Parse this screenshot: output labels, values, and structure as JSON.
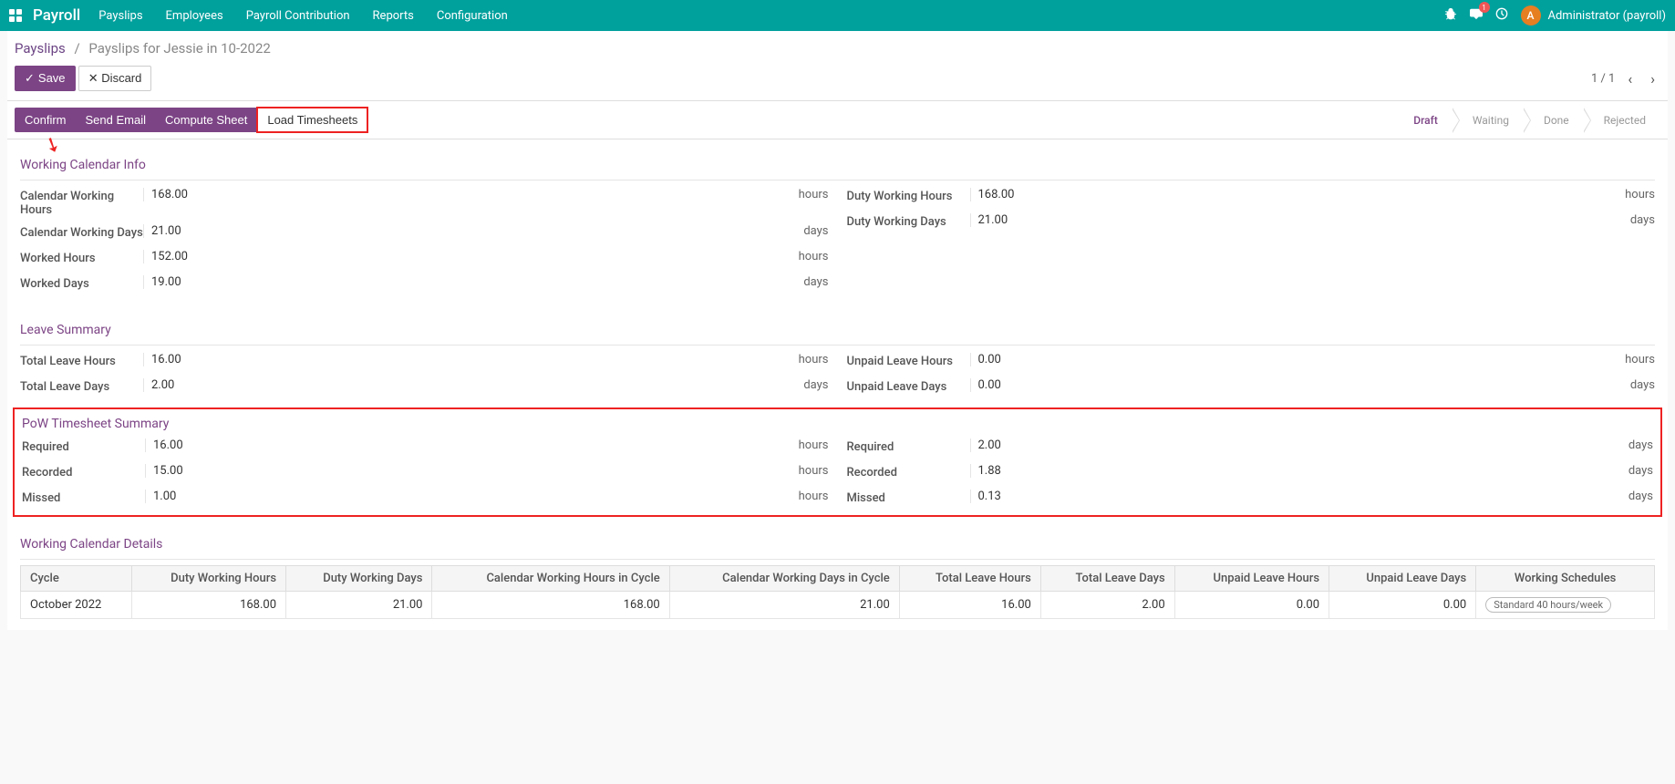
{
  "nav": {
    "brand": "Payroll",
    "menu": [
      "Payslips",
      "Employees",
      "Payroll Contribution",
      "Reports",
      "Configuration"
    ],
    "msg_badge": "1",
    "avatar_letter": "A",
    "user": "Administrator (payroll)"
  },
  "breadcrumb": {
    "root": "Payslips",
    "current": "Payslips for Jessie in 10-2022"
  },
  "actions": {
    "save": "Save",
    "discard": "Discard",
    "pager": "1 / 1"
  },
  "status_buttons": {
    "confirm": "Confirm",
    "send_email": "Send Email",
    "compute": "Compute Sheet",
    "load_ts": "Load Timesheets"
  },
  "status_steps": [
    "Draft",
    "Waiting",
    "Done",
    "Rejected"
  ],
  "sections": {
    "working_cal": "Working Calendar Info",
    "leave": "Leave Summary",
    "pow": "PoW Timesheet Summary",
    "details": "Working Calendar Details"
  },
  "working_cal": {
    "left": [
      {
        "label": "Calendar Working Hours",
        "value": "168.00",
        "unit": "hours"
      },
      {
        "label": "Calendar Working Days",
        "value": "21.00",
        "unit": "days"
      },
      {
        "label": "Worked Hours",
        "value": "152.00",
        "unit": "hours"
      },
      {
        "label": "Worked Days",
        "value": "19.00",
        "unit": "days"
      }
    ],
    "right": [
      {
        "label": "Duty Working Hours",
        "value": "168.00",
        "unit": "hours"
      },
      {
        "label": "Duty Working Days",
        "value": "21.00",
        "unit": "days"
      }
    ]
  },
  "leave": {
    "left": [
      {
        "label": "Total Leave Hours",
        "value": "16.00",
        "unit": "hours"
      },
      {
        "label": "Total Leave Days",
        "value": "2.00",
        "unit": "days"
      }
    ],
    "right": [
      {
        "label": "Unpaid Leave Hours",
        "value": "0.00",
        "unit": "hours"
      },
      {
        "label": "Unpaid Leave Days",
        "value": "0.00",
        "unit": "days"
      }
    ]
  },
  "pow": {
    "left": [
      {
        "label": "Required",
        "value": "16.00",
        "unit": "hours"
      },
      {
        "label": "Recorded",
        "value": "15.00",
        "unit": "hours"
      },
      {
        "label": "Missed",
        "value": "1.00",
        "unit": "hours"
      }
    ],
    "right": [
      {
        "label": "Required",
        "value": "2.00",
        "unit": "days"
      },
      {
        "label": "Recorded",
        "value": "1.88",
        "unit": "days"
      },
      {
        "label": "Missed",
        "value": "0.13",
        "unit": "days"
      }
    ]
  },
  "details": {
    "headers": [
      "Cycle",
      "Duty Working Hours",
      "Duty Working Days",
      "Calendar Working Hours in Cycle",
      "Calendar Working Days in Cycle",
      "Total Leave Hours",
      "Total Leave Days",
      "Unpaid Leave Hours",
      "Unpaid Leave Days",
      "Working Schedules"
    ],
    "row": {
      "cycle": "October 2022",
      "dwh": "168.00",
      "dwd": "21.00",
      "cwh": "168.00",
      "cwd": "21.00",
      "tlh": "16.00",
      "tld": "2.00",
      "ulh": "0.00",
      "uld": "0.00",
      "schedule": "Standard 40 hours/week"
    }
  }
}
